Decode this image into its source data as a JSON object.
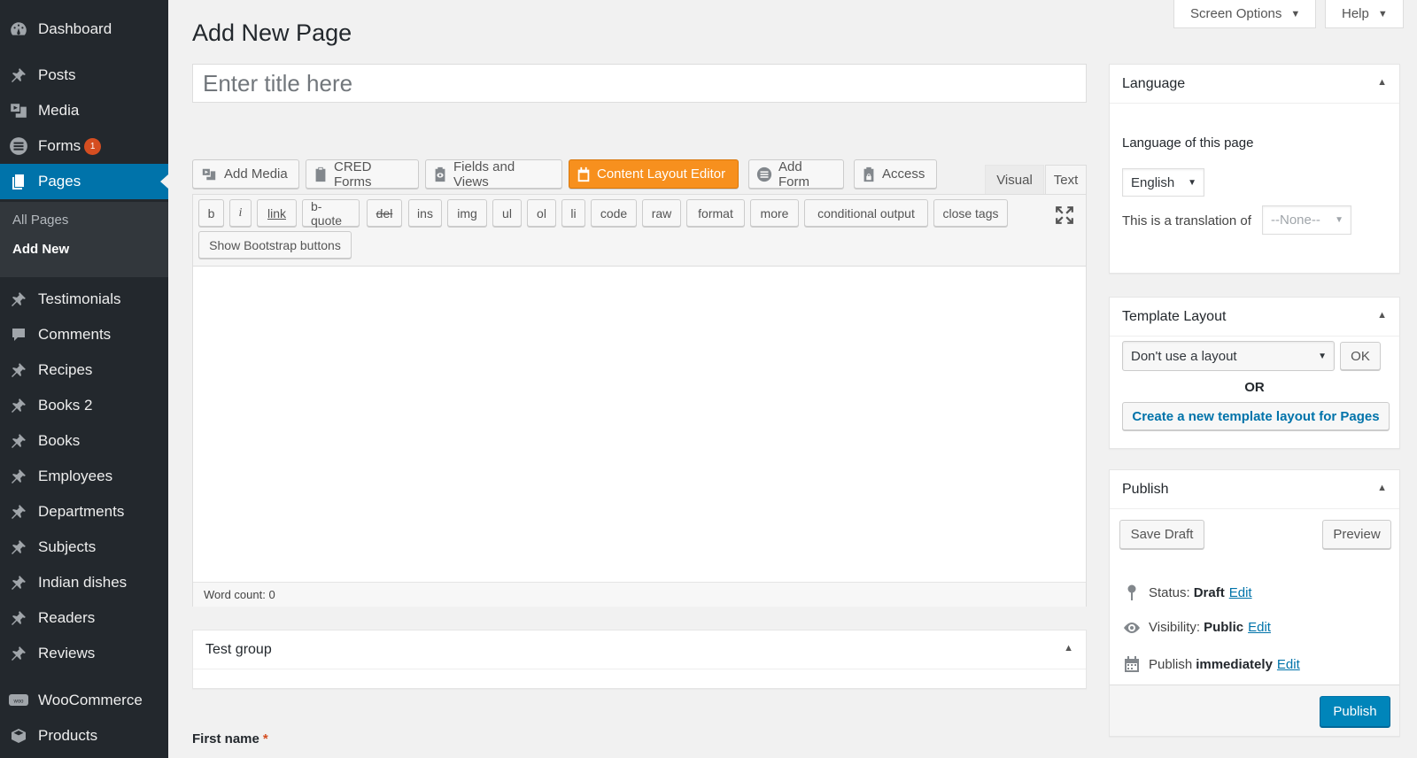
{
  "sidebar": {
    "items": [
      {
        "label": "Dashboard",
        "icon": "dashboard-icon"
      },
      {
        "label": "Posts",
        "icon": "pin-icon"
      },
      {
        "label": "Media",
        "icon": "media-icon"
      },
      {
        "label": "Forms",
        "icon": "forms-icon",
        "badge": "1"
      },
      {
        "label": "Pages",
        "icon": "pages-icon"
      },
      {
        "label": "Testimonials",
        "icon": "pin-icon"
      },
      {
        "label": "Comments",
        "icon": "comment-icon"
      },
      {
        "label": "Recipes",
        "icon": "pin-icon"
      },
      {
        "label": "Books 2",
        "icon": "pin-icon"
      },
      {
        "label": "Books",
        "icon": "pin-icon"
      },
      {
        "label": "Employees",
        "icon": "pin-icon"
      },
      {
        "label": "Departments",
        "icon": "pin-icon"
      },
      {
        "label": "Subjects",
        "icon": "pin-icon"
      },
      {
        "label": "Indian dishes",
        "icon": "pin-icon"
      },
      {
        "label": "Readers",
        "icon": "pin-icon"
      },
      {
        "label": "Reviews",
        "icon": "pin-icon"
      },
      {
        "label": "WooCommerce",
        "icon": "woocommerce-icon"
      },
      {
        "label": "Products",
        "icon": "products-icon"
      }
    ],
    "submenu": [
      "All Pages",
      "Add New"
    ]
  },
  "header": {
    "title": "Add New Page",
    "screen_options": "Screen Options",
    "help": "Help"
  },
  "title_field": {
    "placeholder": "Enter title here",
    "value": ""
  },
  "media_buttons": [
    {
      "label": "Add Media"
    },
    {
      "label": "CRED Forms"
    },
    {
      "label": "Fields and Views"
    },
    {
      "label": "Content Layout Editor"
    },
    {
      "label": "Add Form"
    },
    {
      "label": "Access"
    }
  ],
  "editor_tabs": {
    "visual": "Visual",
    "text": "Text"
  },
  "quicktags": [
    "b",
    "i",
    "link",
    "b-quote",
    "del",
    "ins",
    "img",
    "ul",
    "ol",
    "li",
    "code",
    "raw",
    "format",
    "more",
    "conditional output",
    "close tags",
    "Show Bootstrap buttons"
  ],
  "word_count": "Word count: 0",
  "test_group": {
    "title": "Test group"
  },
  "first_name": {
    "label": "First name",
    "required_mark": "*"
  },
  "language_box": {
    "title": "Language",
    "label": "Language of this page",
    "selected": "English",
    "translation_label": "This is a translation of",
    "translation_value": "--None--"
  },
  "template_box": {
    "title": "Template Layout",
    "selected": "Don't use a layout",
    "ok": "OK",
    "or": "OR",
    "create": "Create a new template layout for Pages"
  },
  "publish_box": {
    "title": "Publish",
    "save_draft": "Save Draft",
    "preview": "Preview",
    "status_label": "Status:",
    "status_value": "Draft",
    "visibility_label": "Visibility:",
    "visibility_value": "Public",
    "publish_label": "Publish",
    "publish_value": "immediately",
    "edit": "Edit",
    "publish_button": "Publish"
  },
  "colors": {
    "accent": "#0073aa",
    "sidebar": "#23282d",
    "orange": "#f7901e",
    "primary": "#0085ba"
  }
}
